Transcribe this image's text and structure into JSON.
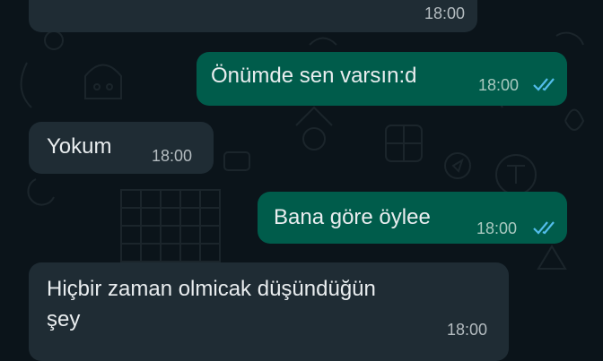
{
  "chat": {
    "messages": [
      {
        "direction": "incoming",
        "text": "",
        "time": "18:00"
      },
      {
        "direction": "outgoing",
        "text": "Önümde sen varsın:d",
        "time": "18:00",
        "status": "read"
      },
      {
        "direction": "incoming",
        "text": "Yokum",
        "time": "18:00"
      },
      {
        "direction": "outgoing",
        "text": "Bana göre öylee",
        "time": "18:00",
        "status": "read"
      },
      {
        "direction": "incoming",
        "text_line1": "Hiçbir zaman olmicak düşündüğün",
        "text_line2": "şey",
        "time": "18:00"
      }
    ]
  },
  "colors": {
    "background": "#0b141a",
    "incoming_bubble": "#1f2c34",
    "outgoing_bubble": "#005c4b",
    "read_ticks": "#53bdeb"
  },
  "icons": {
    "read_receipt": "double-check-icon"
  }
}
